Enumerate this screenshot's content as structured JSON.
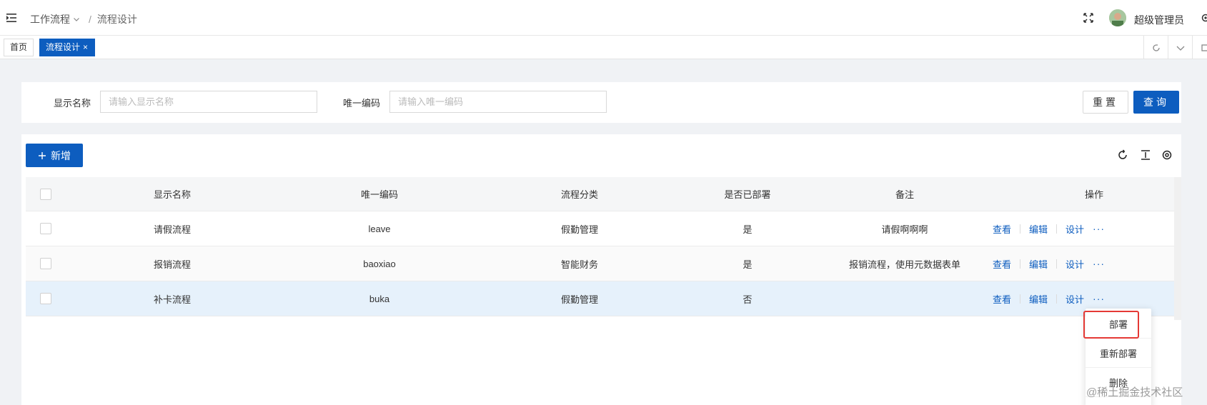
{
  "header": {
    "breadcrumb": [
      "工作流程",
      "流程设计"
    ],
    "separator": "/",
    "username": "超级管理员"
  },
  "tabs": [
    {
      "label": "首页",
      "active": false
    },
    {
      "label": "流程设计",
      "active": true,
      "close": "×"
    }
  ],
  "search": {
    "name_label": "显示名称",
    "name_placeholder": "请输入显示名称",
    "code_label": "唯一编码",
    "code_placeholder": "请输入唯一编码",
    "reset_label": "重置",
    "search_label": "查询"
  },
  "toolbar": {
    "add_label": "新增"
  },
  "table": {
    "columns": [
      "显示名称",
      "唯一编码",
      "流程分类",
      "是否已部署",
      "备注",
      "操作"
    ],
    "rows": [
      {
        "name": "请假流程",
        "code": "leave",
        "category": "假勤管理",
        "deployed": "是",
        "remark": "请假啊啊啊"
      },
      {
        "name": "报销流程",
        "code": "baoxiao",
        "category": "智能财务",
        "deployed": "是",
        "remark": "报销流程，使用元数据表单"
      },
      {
        "name": "补卡流程",
        "code": "buka",
        "category": "假勤管理",
        "deployed": "否",
        "remark": ""
      }
    ],
    "actions": {
      "view": "查看",
      "edit": "编辑",
      "design": "设计",
      "more": "···"
    }
  },
  "dropdown": {
    "items": [
      "部署",
      "重新部署",
      "删除"
    ]
  },
  "watermark": "@稀土掘金技术社区",
  "colors": {
    "primary": "#0d5dbf",
    "highlight_border": "#e53935",
    "hover_row": "#e6f1fb"
  },
  "icons": [
    "menu-fold-icon",
    "chevron-down-icon",
    "fullscreen-icon",
    "avatar",
    "gear-icon",
    "refresh-icon",
    "column-height-icon",
    "setting-icon",
    "plus-icon"
  ]
}
